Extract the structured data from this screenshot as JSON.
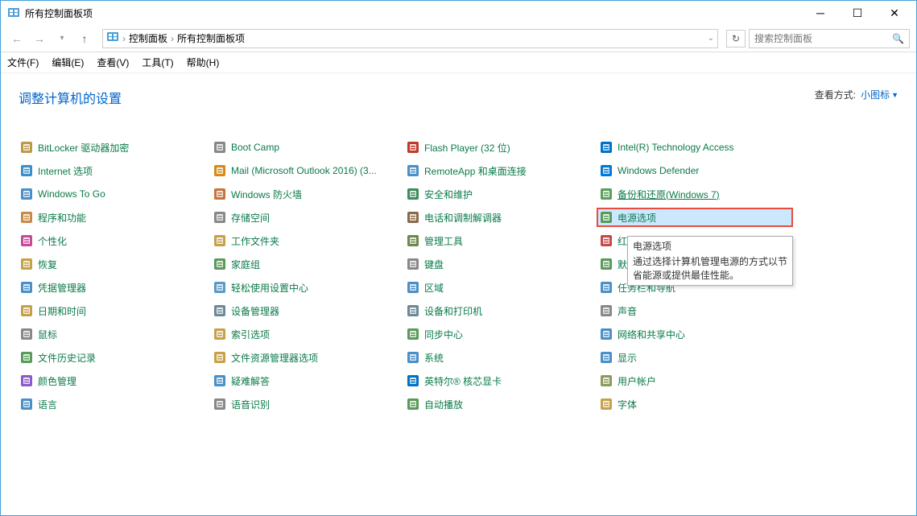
{
  "window": {
    "title": "所有控制面板项"
  },
  "breadcrumb": {
    "root": "控制面板",
    "current": "所有控制面板项"
  },
  "search": {
    "placeholder": "搜索控制面板"
  },
  "menu": {
    "file": "文件(F)",
    "edit": "编辑(E)",
    "view": "查看(V)",
    "tools": "工具(T)",
    "help": "帮助(H)"
  },
  "heading": "调整计算机的设置",
  "viewby": {
    "label": "查看方式:",
    "value": "小图标"
  },
  "tooltip": {
    "title": "电源选项",
    "body": "通过选择计算机管理电源的方式以节省能源或提供最佳性能。"
  },
  "items": [
    {
      "label": "BitLocker 驱动器加密",
      "icon": "lock"
    },
    {
      "label": "Boot Camp",
      "icon": "disk"
    },
    {
      "label": "Flash Player (32 位)",
      "icon": "flash"
    },
    {
      "label": "Intel(R) Technology Access",
      "icon": "intel"
    },
    {
      "label": "Internet 选项",
      "icon": "globe"
    },
    {
      "label": "Mail (Microsoft Outlook 2016) (3...",
      "icon": "mail"
    },
    {
      "label": "RemoteApp 和桌面连接",
      "icon": "remote"
    },
    {
      "label": "Windows Defender",
      "icon": "shield"
    },
    {
      "label": "Windows To Go",
      "icon": "togo"
    },
    {
      "label": "Windows 防火墙",
      "icon": "firewall"
    },
    {
      "label": "安全和维护",
      "icon": "flag"
    },
    {
      "label": "备份和还原(Windows 7)",
      "icon": "backup",
      "underline": true
    },
    {
      "label": "程序和功能",
      "icon": "programs"
    },
    {
      "label": "存储空间",
      "icon": "storage"
    },
    {
      "label": "电话和调制解调器",
      "icon": "phone"
    },
    {
      "label": "电源选项",
      "icon": "power",
      "selected": true,
      "highlighted": true
    },
    {
      "label": "个性化",
      "icon": "personal"
    },
    {
      "label": "工作文件夹",
      "icon": "workfolder"
    },
    {
      "label": "管理工具",
      "icon": "admin"
    },
    {
      "label": "红外线",
      "icon": "infrared"
    },
    {
      "label": "恢复",
      "icon": "recovery"
    },
    {
      "label": "家庭组",
      "icon": "homegroup"
    },
    {
      "label": "键盘",
      "icon": "keyboard"
    },
    {
      "label": "默认程序",
      "icon": "default"
    },
    {
      "label": "凭据管理器",
      "icon": "cred"
    },
    {
      "label": "轻松使用设置中心",
      "icon": "ease"
    },
    {
      "label": "区域",
      "icon": "region"
    },
    {
      "label": "任务栏和导航",
      "icon": "taskbar"
    },
    {
      "label": "日期和时间",
      "icon": "clock"
    },
    {
      "label": "设备管理器",
      "icon": "devmgr"
    },
    {
      "label": "设备和打印机",
      "icon": "printer"
    },
    {
      "label": "声音",
      "icon": "sound"
    },
    {
      "label": "鼠标",
      "icon": "mouse"
    },
    {
      "label": "索引选项",
      "icon": "index"
    },
    {
      "label": "同步中心",
      "icon": "sync"
    },
    {
      "label": "网络和共享中心",
      "icon": "network"
    },
    {
      "label": "文件历史记录",
      "icon": "filehistory"
    },
    {
      "label": "文件资源管理器选项",
      "icon": "explorer"
    },
    {
      "label": "系统",
      "icon": "system"
    },
    {
      "label": "显示",
      "icon": "display"
    },
    {
      "label": "颜色管理",
      "icon": "color"
    },
    {
      "label": "疑难解答",
      "icon": "trouble"
    },
    {
      "label": "英特尔® 核芯显卡",
      "icon": "intelgfx"
    },
    {
      "label": "用户帐户",
      "icon": "users"
    },
    {
      "label": "语言",
      "icon": "lang"
    },
    {
      "label": "语音识别",
      "icon": "speech"
    },
    {
      "label": "自动播放",
      "icon": "autoplay"
    },
    {
      "label": "字体",
      "icon": "fonts"
    }
  ],
  "iconColors": {
    "lock": "#b89a4a",
    "disk": "#888",
    "flash": "#c0392b",
    "intel": "#0071c5",
    "globe": "#3b8ec7",
    "mail": "#d68a1a",
    "remote": "#4a8fc7",
    "shield": "#0078d7",
    "togo": "#4a8fc7",
    "firewall": "#c7743b",
    "flag": "#3b8e5a",
    "backup": "#5aa05a",
    "programs": "#c78a4a",
    "storage": "#888",
    "phone": "#8a6a4a",
    "power": "#5a9a5a",
    "personal": "#c74a9a",
    "workfolder": "#c7a04a",
    "admin": "#6a8a4a",
    "infrared": "#c74a4a",
    "recovery": "#c7a04a",
    "homegroup": "#5a9a5a",
    "keyboard": "#888",
    "default": "#5a9a5a",
    "cred": "#4a8fc7",
    "ease": "#5a9ac7",
    "region": "#4a8fc7",
    "taskbar": "#4a8fc7",
    "clock": "#c7a04a",
    "devmgr": "#6a8a9a",
    "printer": "#6a8a9a",
    "sound": "#888",
    "mouse": "#888",
    "index": "#c7a04a",
    "sync": "#5a9a5a",
    "network": "#4a8fc7",
    "filehistory": "#5a9a5a",
    "explorer": "#c7a04a",
    "system": "#4a8fc7",
    "display": "#4a8fc7",
    "color": "#8a5ac7",
    "trouble": "#4a8fc7",
    "intelgfx": "#0071c5",
    "users": "#8a9a5a",
    "lang": "#4a8fc7",
    "speech": "#888",
    "autoplay": "#5a9a5a",
    "fonts": "#c7a04a"
  }
}
